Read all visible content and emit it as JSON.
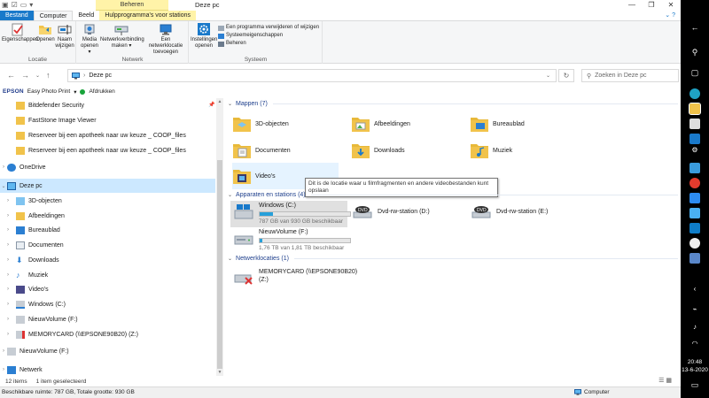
{
  "window": {
    "title": "Deze pc",
    "context_tab_group": "Beheren",
    "controls": [
      "—",
      "❐",
      "✕"
    ]
  },
  "ribbon": {
    "tabs": [
      {
        "label": "Bestand",
        "kind": "file"
      },
      {
        "label": "Computer",
        "kind": "active"
      },
      {
        "label": "Beeld",
        "kind": "normal"
      },
      {
        "label": "Hulpprogramma's voor stations",
        "kind": "ctx"
      }
    ],
    "groups": {
      "locatie": {
        "label": "Locatie",
        "buttons": [
          {
            "name": "properties",
            "label1": "Eigenschappen",
            "label2": ""
          },
          {
            "name": "open",
            "label1": "Openen",
            "label2": ""
          },
          {
            "name": "rename",
            "label1": "Naam",
            "label2": "wijzigen"
          }
        ]
      },
      "netwerk": {
        "label": "Netwerk",
        "buttons": [
          {
            "name": "media",
            "label1": "Media",
            "label2": "openen ▾"
          },
          {
            "name": "map-drive",
            "label1": "Netwerkverbinding",
            "label2": "maken ▾"
          },
          {
            "name": "add-network-location",
            "label1": "Een netwerklocatie",
            "label2": "toevoegen"
          }
        ]
      },
      "systeem": {
        "label": "Systeem",
        "settings_label1": "Instellingen",
        "settings_label2": "openen",
        "links": [
          "Een programma verwijderen of wijzigen",
          "Systeemeigenschappen",
          "Beheren"
        ]
      }
    }
  },
  "address": {
    "path": "Deze pc",
    "search_placeholder": "Zoeken in Deze pc"
  },
  "toolbar": {
    "brand": "EPSON",
    "app": "Easy Photo Print",
    "print": "Afdrukken"
  },
  "nav": {
    "quick": [
      "Bitdefender Security",
      "FastStone Image Viewer",
      "Reserveer bij een apotheek naar uw keuze _ COOP_files",
      "Reserveer bij een apotheek naar uw keuze _ COOP_files"
    ],
    "onedrive": "OneDrive",
    "thispc": "Deze pc",
    "thispc_children": [
      "3D-objecten",
      "Afbeeldingen",
      "Bureaublad",
      "Documenten",
      "Downloads",
      "Muziek",
      "Video's",
      "Windows (C:)",
      "NieuwVolume (F:)",
      "MEMORYCARD (\\\\EPSONE90B20) (Z:)"
    ],
    "nieuwvolume": "NieuwVolume (F:)",
    "network": "Netwerk"
  },
  "content": {
    "folders_header": "Mappen (7)",
    "folders": [
      "3D-objecten",
      "Afbeeldingen",
      "Bureaublad",
      "Documenten",
      "Downloads",
      "Muziek",
      "Video's"
    ],
    "devices_header": "Apparaten en stations (4)",
    "drives": [
      {
        "name": "Windows (C:)",
        "info": "787 GB van 930 GB beschikbaar",
        "used_fraction": 0.15
      },
      {
        "name": "NieuwVolume (F:)",
        "info": "1,76 TB van 1,81 TB beschikbaar",
        "used_fraction": 0.03
      }
    ],
    "dvd": [
      "Dvd-rw-station (D:)",
      "Dvd-rw-station (E:)"
    ],
    "network_header": "Netwerklocaties (1)",
    "network_drive_line1": "MEMORYCARD (\\\\EPSONE90B20)",
    "network_drive_line2": "(Z:)",
    "tooltip": "Dit is de locatie waar u filmfragmenten en andere videobestanden kunt opslaan"
  },
  "status": {
    "items": "12 items",
    "selected": "1 item geselecteerd",
    "details_left": "Beschikbare ruimte: 787 GB, Totale grootte: 930 GB",
    "details_right": "Computer"
  },
  "taskbar": {
    "time": "20:48",
    "date": "13-6-2020"
  },
  "colors": {
    "accent": "#1979ca",
    "selection": "#cce8ff",
    "folder": "#f1c34b",
    "drive_fill": "#26a0da"
  }
}
